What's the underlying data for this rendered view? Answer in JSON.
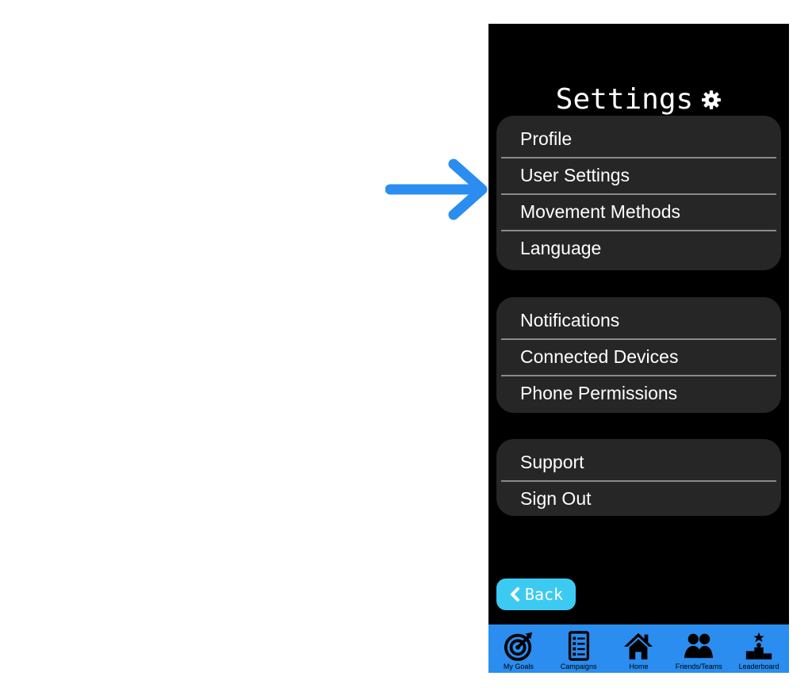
{
  "colors": {
    "arrow": "#2a8def",
    "phone_background": "#000000",
    "group_background": "#262626",
    "separator": "#8a8a8a",
    "text": "#ffffff",
    "back_button": "#3ccaf3",
    "tab_bar": "#2a8def"
  },
  "annotation": {
    "icon": "arrow-right-icon"
  },
  "header": {
    "title": "Settings",
    "icon": "gear-icon"
  },
  "groups": [
    {
      "items": [
        {
          "label": "Profile"
        },
        {
          "label": "User Settings"
        },
        {
          "label": "Movement Methods"
        },
        {
          "label": "Language"
        }
      ]
    },
    {
      "items": [
        {
          "label": "Notifications"
        },
        {
          "label": "Connected Devices"
        },
        {
          "label": "Phone Permissions"
        }
      ]
    },
    {
      "items": [
        {
          "label": "Support"
        },
        {
          "label": "Sign Out"
        }
      ]
    }
  ],
  "back_button": {
    "label": "Back",
    "icon": "chevron-left-icon"
  },
  "tab_bar": {
    "tabs": [
      {
        "label": "My Goals",
        "icon": "target-icon"
      },
      {
        "label": "Campaigns",
        "icon": "checklist-icon"
      },
      {
        "label": "Home",
        "icon": "home-icon"
      },
      {
        "label": "Friends/Teams",
        "icon": "people-icon"
      },
      {
        "label": "Leaderboard",
        "icon": "podium-icon"
      }
    ]
  }
}
